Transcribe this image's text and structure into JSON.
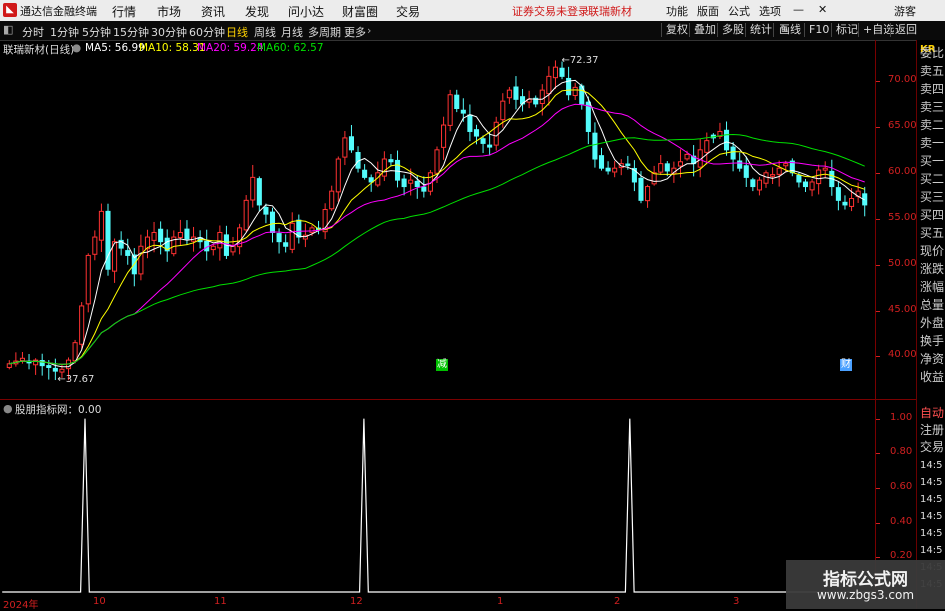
{
  "titlebar": {
    "app_title": "通达信金融终端",
    "menu": [
      "行情",
      "市场",
      "资讯",
      "发现",
      "问小达",
      "财富圈",
      "交易"
    ],
    "warning": "证券交易未登录",
    "stock_name": "联瑞新材",
    "right_menu": [
      "功能",
      "版面",
      "公式",
      "选项"
    ],
    "user": "游客"
  },
  "toolbar": {
    "periods": [
      "分时",
      "1分钟",
      "5分钟",
      "15分钟",
      "30分钟",
      "60分钟",
      "日线",
      "周线",
      "月线",
      "多周期",
      "更多"
    ],
    "active_period": "日线",
    "buttons": [
      "复权",
      "叠加",
      "多股",
      "统计",
      "画线",
      "F10",
      "标记",
      "+自选",
      "返回"
    ]
  },
  "main_header": {
    "stock_label": "联瑞新材(日线)",
    "ma5": "MA5: 56.99",
    "ma10": "MA10: 58.31",
    "ma20": "MA20: 59.24",
    "ma60": "MA60: 62.57"
  },
  "colors": {
    "up": "#ff3232",
    "down": "#54fcfc",
    "ma5": "#ffffff",
    "ma10": "#ffff00",
    "ma20": "#ff00ff",
    "ma60": "#00e000",
    "axis": "#d02020"
  },
  "chart_data": [
    {
      "type": "candlestick",
      "price_ticks": [
        "70.00",
        "65.00",
        "60.00",
        "55.00",
        "50.00",
        "45.00",
        "40.00"
      ],
      "ylim": [
        37,
        72.5
      ],
      "high_label": "72.37",
      "low_label": "37.67",
      "events": [
        {
          "label": "减",
          "color": "#00c000"
        },
        {
          "label": "财",
          "color": "#4aa0ff"
        }
      ],
      "time_ticks": [
        "2024年",
        "10",
        "11",
        "12",
        "1",
        "2",
        "3"
      ],
      "close": [
        39.2,
        39.5,
        39.8,
        39.3,
        39.6,
        39.0,
        38.8,
        38.4,
        38.6,
        39.6,
        41.5,
        45.5,
        51,
        53,
        55.8,
        49.5,
        52.5,
        51.8,
        51,
        49,
        52,
        53,
        53.5,
        52.5,
        51.5,
        53,
        53.5,
        52.8,
        53,
        52.5,
        51.5,
        52,
        53.5,
        51,
        52,
        54,
        57,
        59.5,
        56.5,
        55.5,
        53.5,
        52.5,
        52,
        54.5,
        53,
        53.2,
        54,
        53.8,
        56,
        58,
        61.5,
        63.8,
        62.5,
        60.5,
        59.5,
        59,
        60,
        61.5,
        61.2,
        59.2,
        58.5,
        59.2,
        58.5,
        58,
        60,
        62.5,
        65.2,
        68.5,
        67,
        66.5,
        64.5,
        64,
        63.2,
        62.8,
        65.5,
        67.8,
        69,
        68,
        67.5,
        68,
        67.5,
        69,
        70.5,
        71.5,
        70.5,
        68.5,
        69.3,
        67.5,
        64.5,
        61.5,
        60.5,
        60.2,
        60.5,
        61,
        60.8,
        59,
        57,
        58.5,
        60,
        61,
        60.2,
        60.5,
        61.2,
        62,
        61,
        62.5,
        63.5,
        63.8,
        64.5,
        62.5,
        61.5,
        60.5,
        59.5,
        58.5,
        59.2,
        60,
        59.8,
        60.5,
        61,
        60,
        59,
        58.5,
        59,
        60.3,
        60.5,
        58.5,
        57,
        56.5,
        57.2,
        58,
        56.5
      ]
    },
    {
      "type": "line",
      "indicator": "股朋指标网",
      "label": "股朋指标网：0.00",
      "ticks": [
        "1.00",
        "0.80",
        "0.60",
        "0.40",
        "0.20"
      ],
      "ylim": [
        0,
        1.05
      ],
      "values": [
        0,
        0,
        0,
        0,
        0,
        0,
        0,
        0,
        0,
        0,
        0,
        0,
        0,
        0,
        0,
        0,
        0,
        0,
        0,
        1,
        0,
        0,
        0,
        0,
        0,
        0,
        0,
        0,
        0,
        0,
        0,
        0,
        0,
        0,
        0,
        0,
        0,
        0,
        0,
        0,
        0,
        0,
        0,
        0,
        0,
        0,
        0,
        0,
        0,
        0,
        0,
        0,
        0,
        0,
        0,
        0,
        0,
        0,
        0,
        0,
        0,
        0,
        0,
        0,
        0,
        0,
        0,
        0,
        0,
        0,
        0,
        0,
        0,
        0,
        0,
        0,
        0,
        0,
        0,
        0,
        0,
        0,
        0,
        1,
        0,
        0,
        0,
        0,
        0,
        0,
        0,
        0,
        0,
        0,
        0,
        0,
        0,
        0,
        0,
        0,
        0,
        0,
        0,
        0,
        0,
        0,
        0,
        0,
        0,
        0,
        0,
        0,
        0,
        0,
        0,
        0,
        0,
        0,
        0,
        0,
        0,
        0,
        0,
        0,
        0,
        0,
        0,
        0,
        0,
        0,
        0,
        0,
        0,
        0,
        0,
        0,
        0,
        0,
        0,
        0,
        0,
        0,
        0,
        0,
        1,
        0,
        0,
        0,
        0,
        0,
        0,
        0,
        0,
        0,
        0,
        0,
        0,
        0,
        0,
        0,
        0,
        0,
        0,
        0,
        0,
        0,
        0,
        0,
        0,
        0,
        0,
        0,
        0,
        0,
        0,
        0,
        0,
        0,
        0,
        0,
        0,
        0,
        0,
        0,
        0,
        0,
        0,
        0,
        0,
        0,
        0,
        0,
        0,
        0,
        0,
        0,
        0,
        0,
        0,
        0,
        0
      ]
    }
  ],
  "side_panel": {
    "code": "KR",
    "top_items": [
      "委比",
      "卖五",
      "卖四",
      "卖三",
      "卖二",
      "卖一",
      "买一",
      "买二",
      "买三",
      "买四",
      "买五",
      "现价",
      "涨跌",
      "涨幅",
      "总量",
      "外盘",
      "换手",
      "净资",
      "收益"
    ],
    "bottom_items": [
      "自动",
      "注册",
      "交易"
    ],
    "times": [
      "14:5",
      "14:5",
      "14:5",
      "14:5",
      "14:5",
      "14:5",
      "14:5",
      "14:5"
    ]
  },
  "watermark": {
    "title": "指标公式网",
    "url": "www.zbgs3.com"
  }
}
